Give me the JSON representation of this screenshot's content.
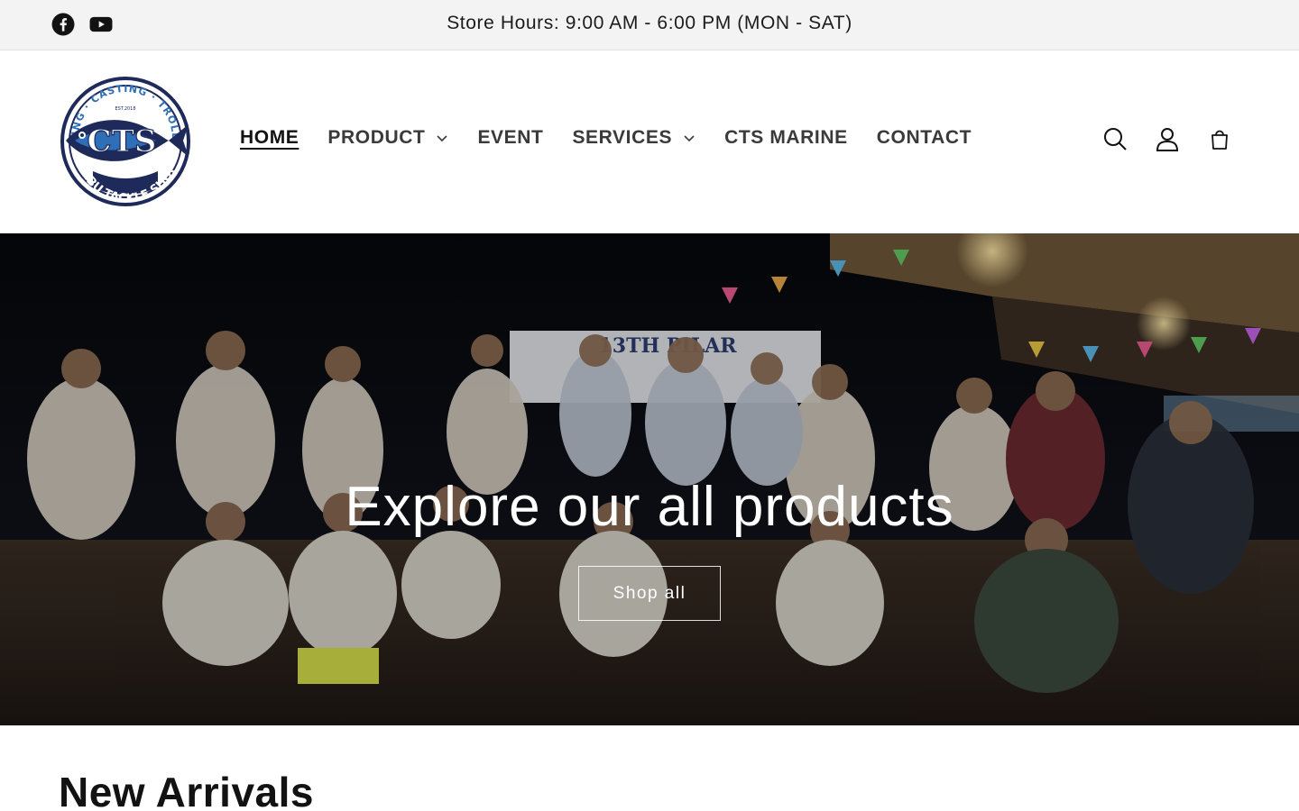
{
  "announcement": {
    "text": "Store Hours: 9:00 AM - 6:00 PM (MON - SAT)",
    "social": [
      {
        "icon": "facebook-icon"
      },
      {
        "icon": "youtube-icon"
      }
    ]
  },
  "header": {
    "logo": {
      "top_text": "JIGGING · CASTING · TROLLING",
      "est": "EST.2018",
      "monogram": "CTS",
      "bottom_text": "CEBU TACKLE SHOP"
    },
    "nav": [
      {
        "label": "HOME",
        "active": true
      },
      {
        "label": "PRODUCT",
        "has_dropdown": true
      },
      {
        "label": "EVENT"
      },
      {
        "label": "SERVICES",
        "has_dropdown": true
      },
      {
        "label": "CTS MARINE"
      },
      {
        "label": "CONTACT"
      }
    ],
    "icons": [
      "search-icon",
      "account-icon",
      "cart-icon"
    ]
  },
  "hero": {
    "title": "Explore our all products",
    "button_label": "Shop all",
    "banner_text": "13TH PILAR"
  },
  "section": {
    "title": "New Arrivals"
  },
  "colors": {
    "announcement_bg": "#f3f3f3",
    "text_dark": "#121212",
    "nav_text": "#3a3a3a",
    "logo_navy": "#1e2a5a",
    "logo_blue": "#2f6fb8"
  }
}
